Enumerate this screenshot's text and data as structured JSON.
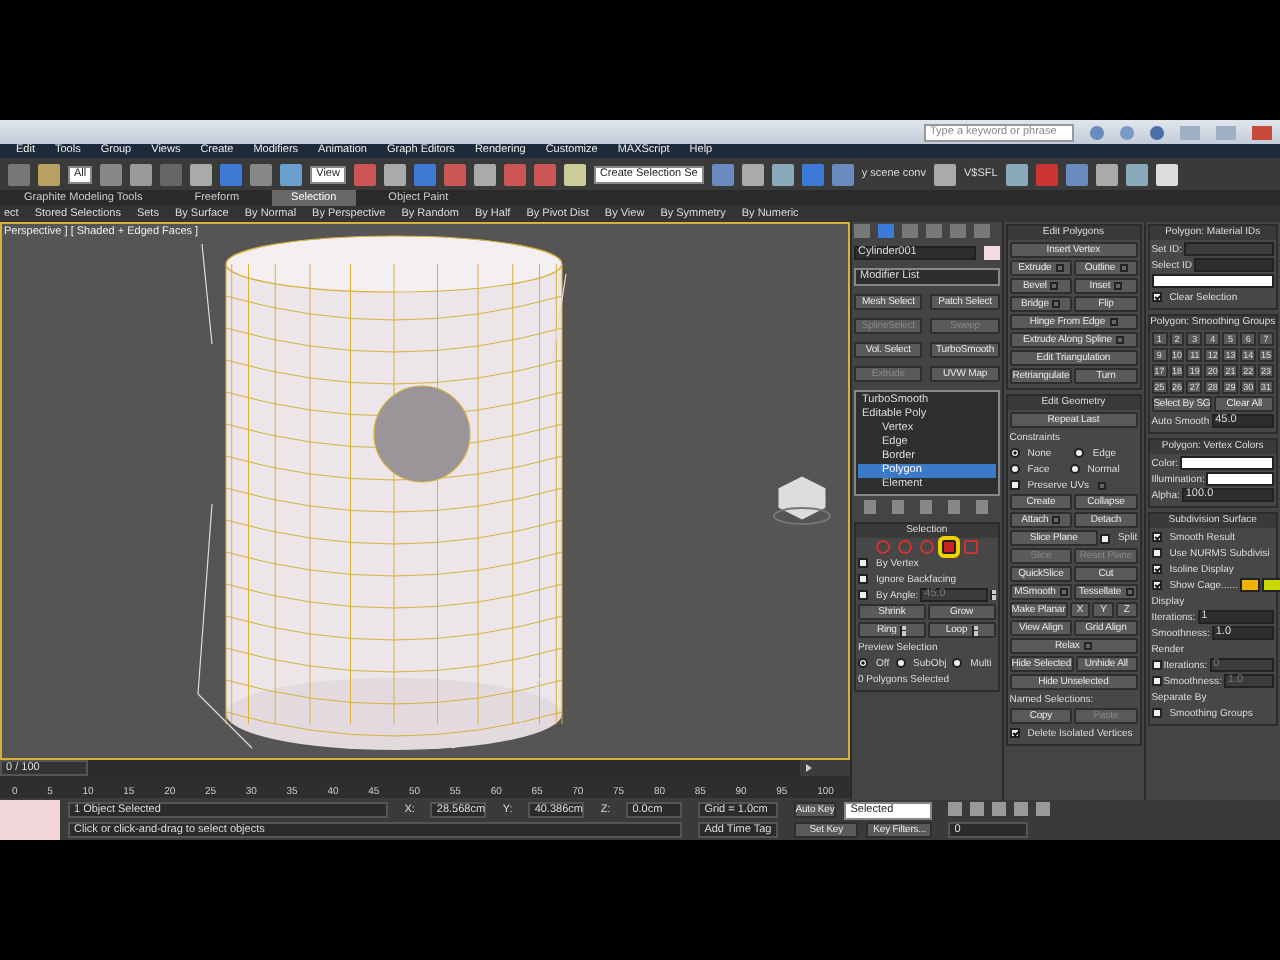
{
  "search": {
    "placeholder": "Type a keyword or phrase"
  },
  "menu": [
    "Edit",
    "Tools",
    "Group",
    "Views",
    "Create",
    "Modifiers",
    "Animation",
    "Graph Editors",
    "Rendering",
    "Customize",
    "MAXScript",
    "Help"
  ],
  "toolbar": {
    "filter": "All",
    "coordinate": "View",
    "selection_set": "Create Selection Se",
    "scene_converter": "y scene conv",
    "label": "V$SFL"
  },
  "ribbon_tabs": [
    {
      "label": "Graphite Modeling Tools",
      "selected": false
    },
    {
      "label": "Freeform",
      "selected": false
    },
    {
      "label": "Selection",
      "selected": true
    },
    {
      "label": "Object Paint",
      "selected": false
    }
  ],
  "ribbon_items": [
    "ect",
    "Stored Selections",
    "Sets",
    "By Surface",
    "By Normal",
    "By Perspective",
    "By Random",
    "By Half",
    "By Pivot Dist",
    "By View",
    "By Symmetry",
    "By Numeric"
  ],
  "viewport": {
    "label": "Perspective ] [ Shaded + Edged Faces ]",
    "active": true
  },
  "command_panel": {
    "object_name": "Cylinder001",
    "modifier_list": "Modifier List",
    "modifier_buttons": [
      {
        "label": "Mesh Select",
        "disabled": false
      },
      {
        "label": "Patch Select",
        "disabled": false
      },
      {
        "label": "SplineSelect",
        "disabled": true
      },
      {
        "label": "Sweep",
        "disabled": true
      },
      {
        "label": "Vol. Select",
        "disabled": false
      },
      {
        "label": "TurboSmooth",
        "disabled": false
      },
      {
        "label": "Extrude",
        "disabled": true
      },
      {
        "label": "UVW Map",
        "disabled": false
      }
    ],
    "stack": [
      {
        "label": "TurboSmooth",
        "selected": false
      },
      {
        "label": "Editable Poly",
        "selected": false,
        "children": [
          {
            "label": "Vertex",
            "selected": false
          },
          {
            "label": "Edge",
            "selected": false
          },
          {
            "label": "Border",
            "selected": false
          },
          {
            "label": "Polygon",
            "selected": true
          },
          {
            "label": "Element",
            "selected": false
          }
        ]
      }
    ],
    "rollouts": [
      {
        "title": "Selection",
        "rows": [
          [
            {
              "kind": "subobject-icons",
              "levels": [
                {
                  "selected": false
                },
                {
                  "selected": false
                },
                {
                  "selected": false
                },
                {
                  "selected": true
                },
                {
                  "selected": false
                }
              ]
            }
          ],
          [
            {
              "kind": "check",
              "label": "By Vertex",
              "checked": false
            }
          ],
          [
            {
              "kind": "check",
              "label": "Ignore Backfacing",
              "checked": false
            }
          ],
          [
            {
              "kind": "check",
              "label": "By Angle:",
              "checked": false
            },
            {
              "kind": "field",
              "value": "45.0",
              "disabled": true,
              "spinner": true
            }
          ],
          [
            {
              "kind": "button",
              "label": "Shrink",
              "disabled": false
            },
            {
              "kind": "button",
              "label": "Grow",
              "disabled": false
            }
          ],
          [
            {
              "kind": "button",
              "label": "Ring",
              "disabled": false,
              "spinner": true
            },
            {
              "kind": "button",
              "label": "Loop",
              "disabled": false,
              "spinner": true
            }
          ],
          [
            {
              "kind": "label",
              "label": "Preview Selection"
            }
          ],
          [
            {
              "kind": "radio",
              "label": "Off",
              "selected": true
            },
            {
              "kind": "radio",
              "label": "SubObj",
              "selected": false
            },
            {
              "kind": "radio",
              "label": "Multi",
              "selected": false
            }
          ],
          [
            {
              "kind": "label",
              "label": "0 Polygons Selected"
            }
          ]
        ]
      }
    ]
  },
  "middle_rollouts": [
    {
      "title": "Edit Polygons",
      "rows": [
        [
          {
            "kind": "button",
            "label": "Insert Vertex",
            "disabled": false
          }
        ],
        [
          {
            "kind": "button",
            "label": "Extrude",
            "disabled": false,
            "settings": true
          },
          {
            "kind": "button",
            "label": "Outline",
            "disabled": false,
            "settings": true
          }
        ],
        [
          {
            "kind": "button",
            "label": "Bevel",
            "disabled": false,
            "settings": true
          },
          {
            "kind": "button",
            "label": "Inset",
            "disabled": false,
            "settings": true
          }
        ],
        [
          {
            "kind": "button",
            "label": "Bridge",
            "disabled": false,
            "settings": true
          },
          {
            "kind": "button",
            "label": "Flip",
            "disabled": false
          }
        ],
        [
          {
            "kind": "button",
            "label": "Hinge From Edge",
            "disabled": false,
            "settings": true
          }
        ],
        [
          {
            "kind": "button",
            "label": "Extrude Along Spline",
            "disabled": false,
            "settings": true
          }
        ],
        [
          {
            "kind": "button",
            "label": "Edit Triangulation",
            "disabled": false
          }
        ],
        [
          {
            "kind": "button",
            "label": "Retriangulate",
            "disabled": false
          },
          {
            "kind": "button",
            "label": "Turn",
            "disabled": false
          }
        ]
      ]
    },
    {
      "title": "Edit Geometry",
      "rows": [
        [
          {
            "kind": "button",
            "label": "Repeat Last",
            "disabled": false
          }
        ],
        [
          {
            "kind": "label",
            "label": "Constraints"
          }
        ],
        [
          {
            "kind": "radio",
            "label": "None",
            "selected": true
          },
          {
            "kind": "radio",
            "label": "Edge",
            "selected": false
          }
        ],
        [
          {
            "kind": "radio",
            "label": "Face",
            "selected": false
          },
          {
            "kind": "radio",
            "label": "Normal",
            "selected": false
          }
        ],
        [
          {
            "kind": "check",
            "label": "Preserve UVs",
            "checked": false,
            "settings": true
          }
        ],
        [
          {
            "kind": "button",
            "label": "Create",
            "disabled": false
          },
          {
            "kind": "button",
            "label": "Collapse",
            "disabled": false
          }
        ],
        [
          {
            "kind": "button",
            "label": "Attach",
            "disabled": false,
            "settings": true
          },
          {
            "kind": "button",
            "label": "Detach",
            "disabled": false
          }
        ],
        [
          {
            "kind": "button",
            "label": "Slice Plane",
            "disabled": false
          },
          {
            "kind": "check",
            "label": "Split",
            "checked": false
          }
        ],
        [
          {
            "kind": "button",
            "label": "Slice",
            "disabled": true
          },
          {
            "kind": "button",
            "label": "Reset Plane",
            "disabled": true
          }
        ],
        [
          {
            "kind": "button",
            "label": "QuickSlice",
            "disabled": false
          },
          {
            "kind": "button",
            "label": "Cut",
            "disabled": false
          }
        ],
        [
          {
            "kind": "button",
            "label": "MSmooth",
            "disabled": false,
            "settings": true
          },
          {
            "kind": "button",
            "label": "Tessellate",
            "disabled": false,
            "settings": true
          }
        ],
        [
          {
            "kind": "button",
            "label": "Make Planar",
            "disabled": false
          },
          {
            "kind": "button",
            "label": "X",
            "disabled": false
          },
          {
            "kind": "button",
            "label": "Y",
            "disabled": false
          },
          {
            "kind": "button",
            "label": "Z",
            "disabled": false
          }
        ],
        [
          {
            "kind": "button",
            "label": "View Align",
            "disabled": false
          },
          {
            "kind": "button",
            "label": "Grid Align",
            "disabled": false
          }
        ],
        [
          {
            "kind": "button",
            "label": "Relax",
            "disabled": false,
            "settings": true
          }
        ],
        [
          {
            "kind": "button",
            "label": "Hide Selected",
            "disabled": false
          },
          {
            "kind": "button",
            "label": "Unhide All",
            "disabled": false
          }
        ],
        [
          {
            "kind": "button",
            "label": "Hide Unselected",
            "disabled": false
          }
        ],
        [
          {
            "kind": "label",
            "label": "Named Selections:"
          }
        ],
        [
          {
            "kind": "button",
            "label": "Copy",
            "disabled": false
          },
          {
            "kind": "button",
            "label": "Paste",
            "disabled": true
          }
        ],
        [
          {
            "kind": "check",
            "label": "Delete Isolated Vertices",
            "checked": true
          }
        ]
      ]
    }
  ],
  "right_rollouts": [
    {
      "title": "Polygon: Material IDs",
      "rows": [
        [
          {
            "kind": "field",
            "label": "Set ID:",
            "disabled": true
          }
        ],
        [
          {
            "kind": "field",
            "label": "Select ID",
            "disabled": false
          }
        ],
        [
          {
            "kind": "swatch",
            "color": "#ffffff"
          }
        ],
        [
          {
            "kind": "check",
            "label": "Clear Selection",
            "checked": true
          }
        ]
      ]
    },
    {
      "title": "Polygon: Smoothing Groups",
      "rows": [
        [
          {
            "kind": "sg-grid",
            "numbers": [
              "1",
              "2",
              "3",
              "4",
              "5",
              "6",
              "7",
              "9",
              "10",
              "11",
              "12",
              "13",
              "14",
              "15",
              "17",
              "18",
              "19",
              "20",
              "21",
              "22",
              "23",
              "25",
              "26",
              "27",
              "28",
              "29",
              "30",
              "31"
            ]
          }
        ],
        [
          {
            "kind": "button",
            "label": "Select By SG",
            "disabled": false
          },
          {
            "kind": "button",
            "label": "Clear All",
            "disabled": false
          }
        ],
        [
          {
            "kind": "field",
            "label": "Auto Smooth",
            "value": "45.0",
            "disabled": false
          }
        ]
      ]
    },
    {
      "title": "Polygon: Vertex Colors",
      "rows": [
        [
          {
            "kind": "swatch",
            "label": "Color:",
            "color": "#ffffff"
          }
        ],
        [
          {
            "kind": "swatch",
            "label": "Illumination:",
            "color": "#ffffff"
          }
        ],
        [
          {
            "kind": "field",
            "label": "Alpha:",
            "value": "100.0",
            "disabled": false
          }
        ]
      ]
    },
    {
      "title": "Subdivision Surface",
      "rows": [
        [
          {
            "kind": "check",
            "label": "Smooth Result",
            "checked": true
          }
        ],
        [
          {
            "kind": "check",
            "label": "Use NURMS Subdivisi",
            "checked": false
          }
        ],
        [
          {
            "kind": "check",
            "label": "Isoline Display",
            "checked": true
          }
        ],
        [
          {
            "kind": "check",
            "label": "Show Cage......",
            "checked": true
          },
          {
            "kind": "swatch",
            "color": "#f0b400"
          },
          {
            "kind": "swatch",
            "color": "#c8d800"
          }
        ],
        [
          {
            "kind": "label",
            "label": "Display"
          }
        ],
        [
          {
            "kind": "field",
            "label": "Iterations:",
            "value": "1",
            "disabled": false
          }
        ],
        [
          {
            "kind": "field",
            "label": "Smoothness:",
            "value": "1.0",
            "disabled": false
          }
        ],
        [
          {
            "kind": "label",
            "label": "Render"
          }
        ],
        [
          {
            "kind": "field",
            "label": "Iterations:",
            "checked": false,
            "value": "0",
            "disabled": true
          }
        ],
        [
          {
            "kind": "field",
            "label": "Smoothness:",
            "checked": false,
            "value": "1.0",
            "disabled": true
          }
        ],
        [
          {
            "kind": "label",
            "label": "Separate By"
          }
        ],
        [
          {
            "kind": "check",
            "label": "Smoothing Groups",
            "checked": false
          }
        ]
      ]
    }
  ],
  "timeline": {
    "frame": "0 / 100",
    "ticks": [
      "0",
      "5",
      "10",
      "15",
      "20",
      "25",
      "30",
      "35",
      "40",
      "45",
      "50",
      "55",
      "60",
      "65",
      "70",
      "75",
      "80",
      "85",
      "90",
      "95",
      "100"
    ]
  },
  "status": {
    "selection": "1 Object Selected",
    "prompt": "Click or click-and-drag to select objects",
    "coordinates": [
      {
        "label": "X:",
        "value": "28.568cm"
      },
      {
        "label": "Y:",
        "value": "40.386cm"
      },
      {
        "label": "Z:",
        "value": "0.0cm"
      }
    ],
    "grid": "Grid = 1.0cm",
    "time_tag": "Add Time Tag",
    "auto_key": "Auto Key",
    "key_mode": "Selected",
    "set_key": "Set Key",
    "key_filters": "Key Filters...",
    "frame": "0"
  }
}
